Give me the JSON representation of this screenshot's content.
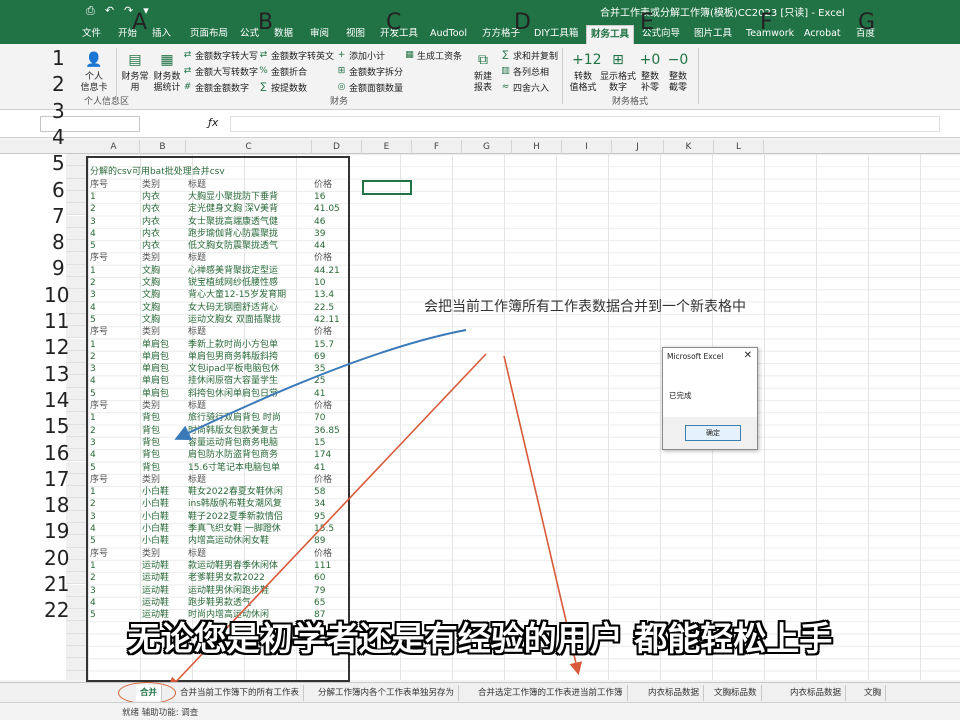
{
  "window": {
    "title": "合并工作表或分解工作簿(模板)CC2023 [只读] - Excel",
    "quick_access": [
      "⎙",
      "↶",
      "↷",
      "▾"
    ]
  },
  "ribbon_tabs": [
    {
      "label": "文件"
    },
    {
      "label": "开始"
    },
    {
      "label": "插入"
    },
    {
      "label": "页面布局"
    },
    {
      "label": "公式"
    },
    {
      "label": "数据"
    },
    {
      "label": "审阅"
    },
    {
      "label": "视图"
    },
    {
      "label": "开发工具"
    },
    {
      "label": "AudTool"
    },
    {
      "label": "方方格子"
    },
    {
      "label": "DIY工具箱"
    },
    {
      "label": "财务工具"
    },
    {
      "label": "公式向导"
    },
    {
      "label": "图片工具"
    },
    {
      "label": "Teamwork"
    },
    {
      "label": "Acrobat"
    },
    {
      "label": "百度"
    }
  ],
  "active_tab": "财务工具",
  "ribbon": {
    "personal": {
      "label_1": "个人",
      "label_2": "信息卡",
      "group": "个人信息区"
    },
    "btn_finance_format": "财务常用",
    "btn_finance_count": "财务数据统计",
    "row1": [
      "金额数字转大写",
      "金额数字转英文",
      "添加小计",
      "生成工资条"
    ],
    "row2": [
      "金额大写转数字",
      "金额折合",
      "金额数字拆分"
    ],
    "row3": [
      "金额金额数字",
      "按提数数",
      "金额面额数量"
    ],
    "group_finance": "财务",
    "btn_new_report": "新建",
    "btn_new_report_2": "报表",
    "row1b": "求和并复制",
    "row2b": "各列总相",
    "row3b": "四舍六入",
    "fmt_buttons": [
      {
        "icon": "+12",
        "l1": "转数",
        "l2": "值格式"
      },
      {
        "icon": "⊞",
        "l1": "显示格式",
        "l2": "数字"
      },
      {
        "icon": "+0",
        "l1": "整数",
        "l2": "补零"
      },
      {
        "icon": "−0",
        "l1": "整数",
        "l2": "截零"
      }
    ],
    "group_format": "财务格式"
  },
  "formula_bar": {
    "fx": "ƒx",
    "value": ""
  },
  "columns": [
    "A",
    "B",
    "C",
    "D",
    "E",
    "F",
    "G",
    "H",
    "I",
    "J",
    "K",
    "L"
  ],
  "big_letters": [
    "A",
    "B",
    "C",
    "D",
    "E",
    "F",
    "G"
  ],
  "row_numbers": [
    "1",
    "2",
    "3",
    "4",
    "5",
    "6",
    "7",
    "8",
    "9",
    "10",
    "11",
    "12",
    "13",
    "14",
    "15",
    "16",
    "17",
    "18",
    "19",
    "20",
    "21",
    "22"
  ],
  "sheet": {
    "heading": "分解的csv可用bat批处理合并csv",
    "rows": [
      [
        "序号",
        "类别",
        "标题",
        "价格"
      ],
      [
        "1",
        "内衣",
        "大胸显小聚拢防下垂背",
        "16"
      ],
      [
        "2",
        "内衣",
        "定光健身文胸 深V美背",
        "41.05"
      ],
      [
        "3",
        "内衣",
        "女士聚拢高端康透气健",
        "46"
      ],
      [
        "4",
        "内衣",
        "跑步瑜伽背心防震聚拢",
        "39"
      ],
      [
        "5",
        "内衣",
        "低文胸女防震聚拢透气",
        "44"
      ],
      [
        "序号",
        "类别",
        "标题",
        "价格"
      ],
      [
        "1",
        "文胸",
        "心禅感美背聚拢定型运",
        "44.21"
      ],
      [
        "2",
        "文胸",
        "锐宝植绒网纱低腰性感",
        "10"
      ],
      [
        "3",
        "文胸",
        "背心大童12-15岁发育期",
        "13.4"
      ],
      [
        "4",
        "文胸",
        "女大码无钢圈舒适背心",
        "22.5"
      ],
      [
        "5",
        "文胸",
        "运动文胸女 双面插聚拢",
        "42.11"
      ],
      [
        "序号",
        "类别",
        "标题",
        "价格"
      ],
      [
        "1",
        "单肩包",
        "季新上款时尚小方包单",
        "15.7"
      ],
      [
        "2",
        "单肩包",
        "单肩包男商务韩版斜挎",
        "69"
      ],
      [
        "3",
        "单肩包",
        "文包ipad平板电脑包休",
        "35"
      ],
      [
        "4",
        "单肩包",
        "挂休闲原宿大容量学生",
        "25"
      ],
      [
        "5",
        "单肩包",
        "斜挎包休闲单肩包日常",
        "41"
      ],
      [
        "序号",
        "类别",
        "标题",
        "价格"
      ],
      [
        "1",
        "背包",
        "旅行骑行双肩背包 时尚",
        "70"
      ],
      [
        "2",
        "背包",
        "时尚韩版女包欧美复古",
        "36.85"
      ],
      [
        "3",
        "背包",
        "容量运动背包商务电脑",
        "15"
      ],
      [
        "4",
        "背包",
        "肩包防水防盗背包商务",
        "174"
      ],
      [
        "5",
        "背包",
        "15.6寸笔记本电脑包单",
        "41"
      ],
      [
        "序号",
        "类别",
        "标题",
        "价格"
      ],
      [
        "1",
        "小白鞋",
        "鞋女2022春夏女鞋休闲",
        "58"
      ],
      [
        "2",
        "小白鞋",
        "ins韩版帆布鞋女潮风复",
        "34"
      ],
      [
        "3",
        "小白鞋",
        "鞋子2022夏季新款情侣",
        "95"
      ],
      [
        "4",
        "小白鞋",
        "季真飞织女鞋 一脚蹬休",
        "15.5"
      ],
      [
        "5",
        "小白鞋",
        "内增高运动休闲女鞋",
        "89"
      ],
      [
        "序号",
        "类别",
        "标题",
        "价格"
      ],
      [
        "1",
        "运动鞋",
        "款运动鞋男春季休闲体",
        "111"
      ],
      [
        "2",
        "运动鞋",
        "老爹鞋男女款2022",
        "60"
      ],
      [
        "3",
        "运动鞋",
        "运动鞋男休闲跑步鞋",
        "79"
      ],
      [
        "4",
        "运动鞋",
        "跑步鞋男款透气",
        "65"
      ],
      [
        "5",
        "运动鞋",
        "时尚内增高运动休闲",
        "87"
      ]
    ]
  },
  "dialog": {
    "title": "Microsoft Excel",
    "close": "✕",
    "message": "已完成",
    "ok_label": "确定"
  },
  "annotation": "会把当前工作簿所有工作表数据合并到一个新表格中",
  "subtitle": "无论您是初学者还是有经验的用户 都能轻松上手",
  "sheet_tabs": [
    {
      "label": "合并"
    },
    {
      "label": "合并当前工作簿下的所有工作表"
    },
    {
      "label": "分解工作簿内各个工作表单独另存为"
    },
    {
      "label": "合并选定工作簿的工作表进当前工作簿"
    },
    {
      "label": "内衣标品数据"
    },
    {
      "label": "文胸标品数"
    },
    {
      "label": "内衣标品数据"
    },
    {
      "label": "文胸"
    }
  ],
  "status": {
    "text": "就绪  辅助功能: 调查"
  },
  "colors": {
    "excel_green": "#217346",
    "arrow_blue": "#3a7ab8",
    "arrow_red": "#d85a3a"
  }
}
